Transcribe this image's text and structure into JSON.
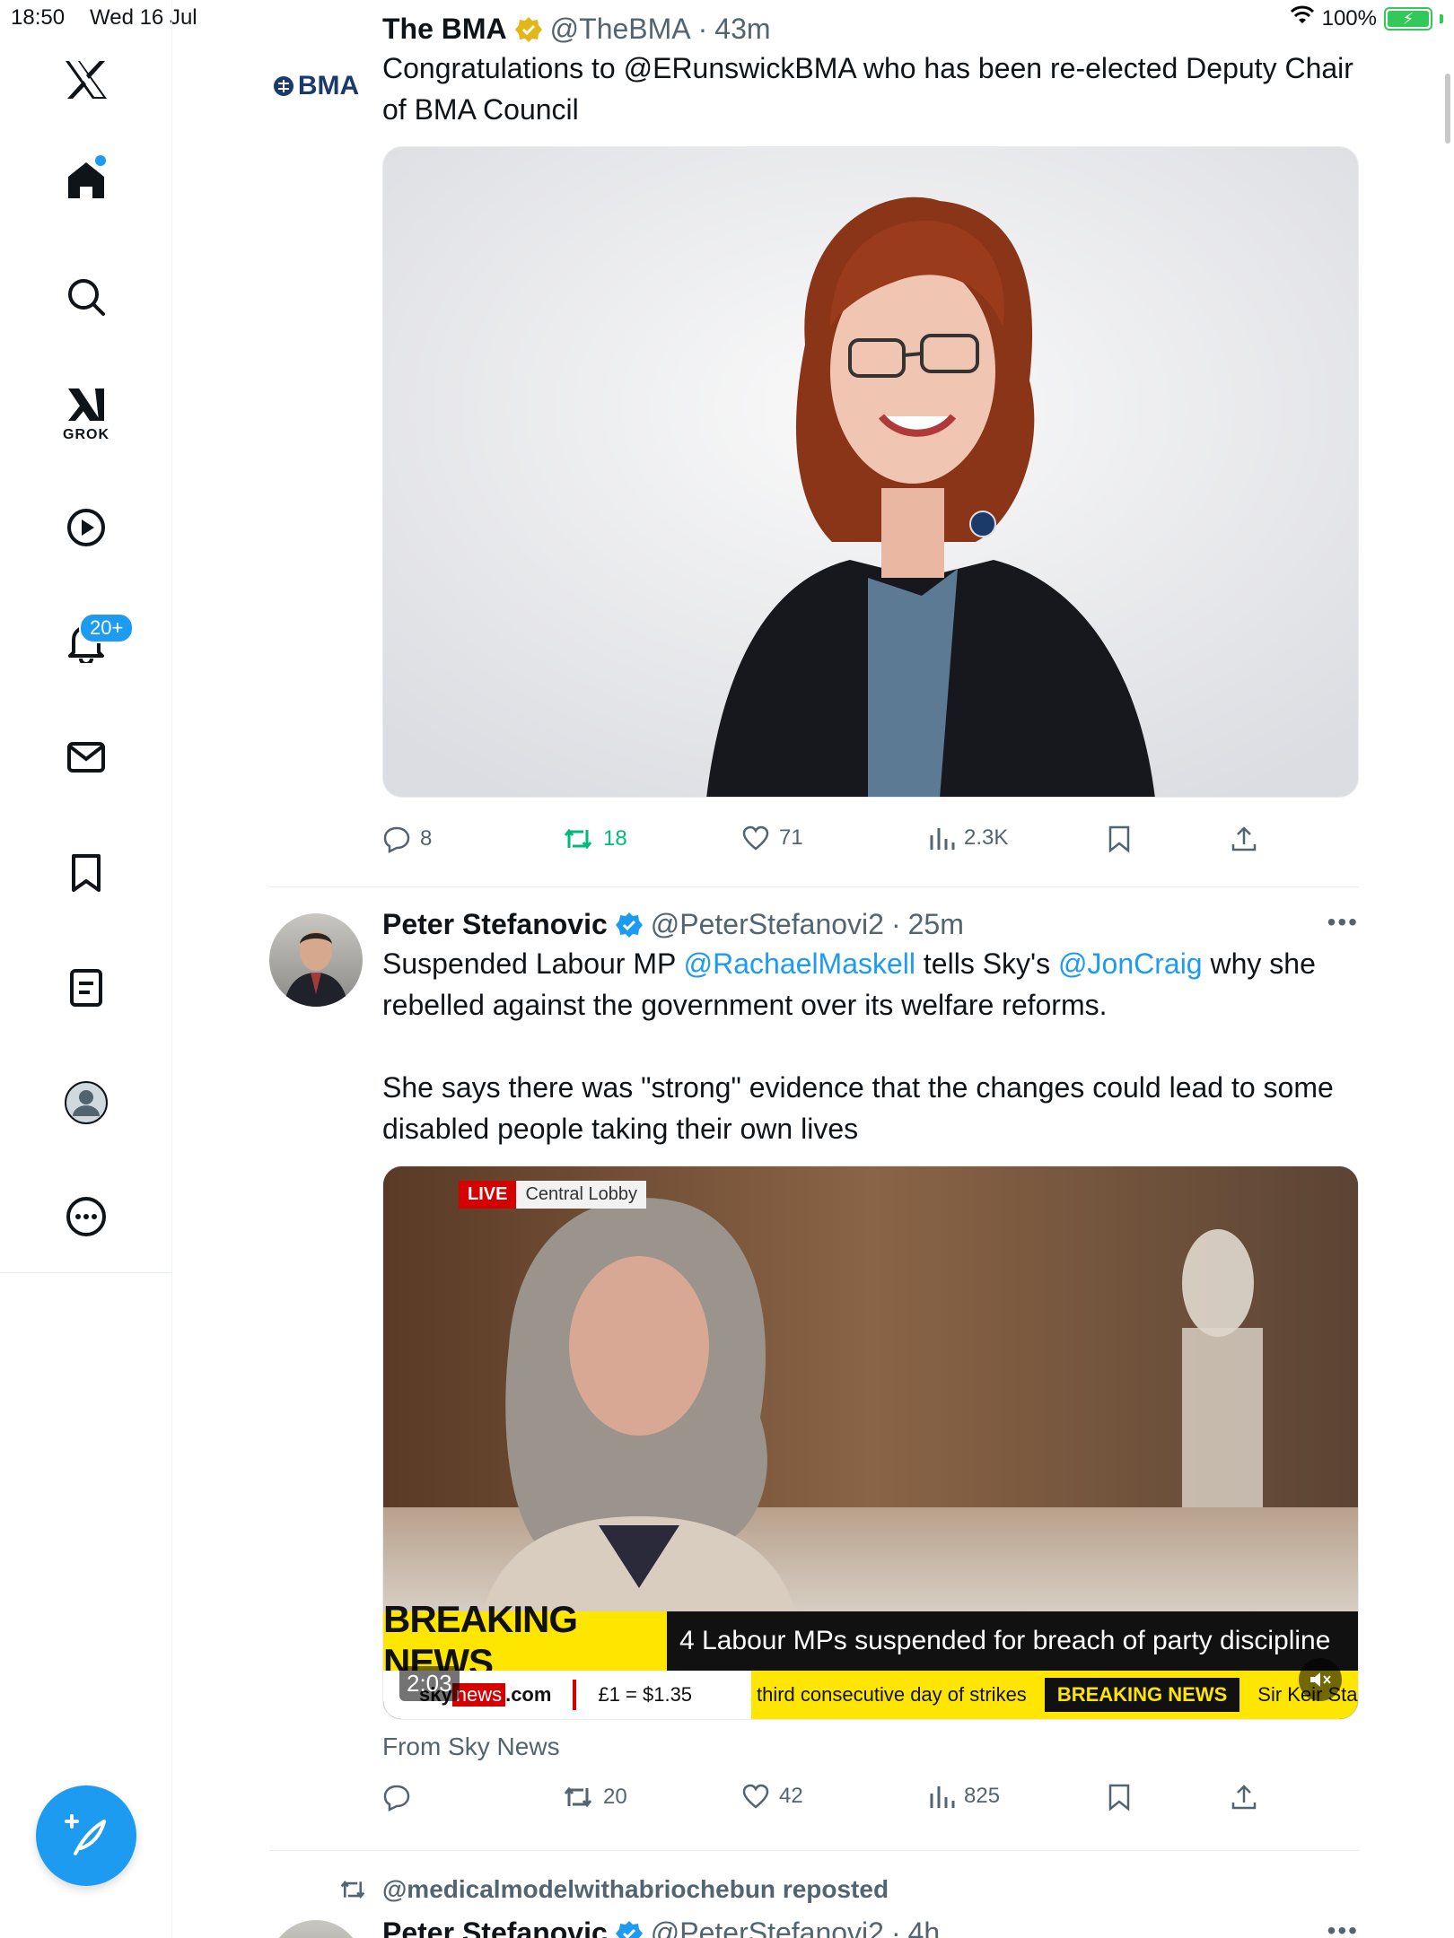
{
  "status_bar": {
    "time": "18:50",
    "date": "Wed 16 Jul",
    "battery": "100%"
  },
  "sidebar": {
    "notifications_badge": "20+",
    "grok_label": "GROK"
  },
  "colors": {
    "accent": "#1d9bf0",
    "retweet_green": "#00ba7c",
    "gold_verified": "#e2b719"
  },
  "tweets": [
    {
      "name": "The BMA",
      "handle": "@TheBMA",
      "sep": "·",
      "time": "43m",
      "avatar_text": "BMA",
      "text_parts": [
        "Congratulations to @ERunswickBMA who has been re-elected Deputy Chair of BMA Council"
      ],
      "replies": "8",
      "retweets": "18",
      "likes": "71",
      "views": "2.3K"
    },
    {
      "name": "Peter Stefanovic",
      "handle": "@PeterStefanovi2",
      "sep": "·",
      "time": "25m",
      "text_a": "Suspended Labour MP ",
      "mention1": "@RachaelMaskell",
      "text_b": " tells Sky's ",
      "mention2": "@JonCraig",
      "text_c": " why she rebelled against the government over its welfare reforms.",
      "text_d": "She says there was \"strong\" evidence that the changes could lead to some disabled people taking their own lives",
      "video": {
        "live": "LIVE",
        "location": "Central Lobby",
        "breaking": "BREAKING NEWS",
        "headline": "4 Labour MPs suspended for breach of party discipline",
        "site_a": "sky",
        "site_b": "news",
        "site_c": ".com",
        "rate": "£1 = $1.35",
        "ticker1": "third consecutive day of strikes",
        "ticker2": "BREAKING NEWS",
        "ticker3": "Sir Keir Starm",
        "duration": "2:03"
      },
      "from": "From Sky News",
      "replies": "",
      "retweets": "20",
      "likes": "42",
      "views": "825"
    }
  ],
  "repost": {
    "label": "@medicalmodelwithabriochebun reposted",
    "name": "Peter Stefanovic",
    "handle": "@PeterStefanovi2",
    "sep": "·",
    "time": "4h"
  }
}
